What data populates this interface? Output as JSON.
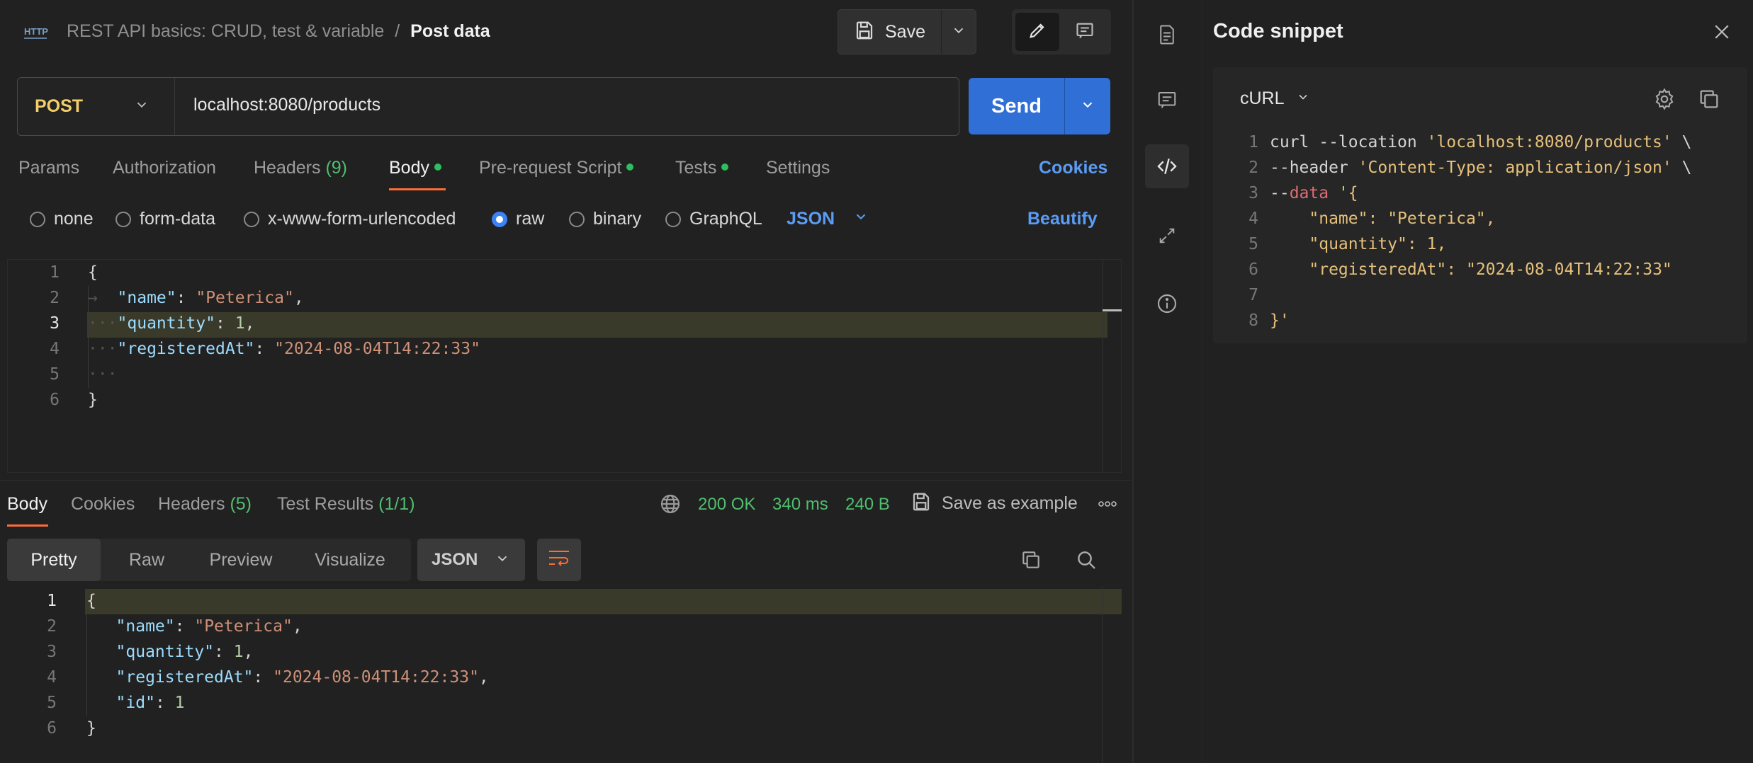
{
  "header": {
    "breadcrumb_parent": "REST API basics: CRUD, test & variable",
    "separator": "/",
    "title": "Post data",
    "save_label": "Save"
  },
  "request": {
    "method": "POST",
    "url": "localhost:8080/products",
    "send_label": "Send"
  },
  "request_tabs": {
    "params": "Params",
    "authorization": "Authorization",
    "headers": "Headers",
    "headers_count": "(9)",
    "body": "Body",
    "prerequest": "Pre-request Script",
    "tests": "Tests",
    "settings": "Settings",
    "cookies": "Cookies"
  },
  "body_types": {
    "none": "none",
    "form_data": "form-data",
    "urlencoded": "x-www-form-urlencoded",
    "raw": "raw",
    "binary": "binary",
    "graphql": "GraphQL",
    "format": "JSON",
    "beautify": "Beautify"
  },
  "request_body": {
    "lines": [
      "1",
      "2",
      "3",
      "4",
      "5",
      "6"
    ],
    "name_key": "\"name\"",
    "name_val": "\"Peterica\"",
    "qty_key": "\"quantity\"",
    "qty_val": "1",
    "reg_key": "\"registeredAt\"",
    "reg_val": "\"2024-08-04T14:22:33\""
  },
  "response_tabs": {
    "body": "Body",
    "cookies": "Cookies",
    "headers": "Headers",
    "headers_count": "(5)",
    "test_results": "Test Results",
    "test_count": "(1/1)",
    "status": "200 OK",
    "time": "340 ms",
    "size": "240 B",
    "save_example": "Save as example"
  },
  "response_views": {
    "pretty": "Pretty",
    "raw": "Raw",
    "preview": "Preview",
    "visualize": "Visualize",
    "format": "JSON"
  },
  "response_body": {
    "lines": [
      "1",
      "2",
      "3",
      "4",
      "5",
      "6"
    ],
    "name_key": "\"name\"",
    "name_val": "\"Peterica\"",
    "qty_key": "\"quantity\"",
    "qty_val": "1",
    "reg_key": "\"registeredAt\"",
    "reg_val": "\"2024-08-04T14:22:33\"",
    "id_key": "\"id\"",
    "id_val": "1"
  },
  "snippet": {
    "title": "Code snippet",
    "language": "cURL",
    "lines": [
      "1",
      "2",
      "3",
      "4",
      "5",
      "6",
      "7",
      "8"
    ],
    "l1_cmd": "curl --location ",
    "l1_str": "'localhost:8080/products'",
    "l1_end": " \\",
    "l2_cmd": "--header ",
    "l2_str": "'Content-Type: application/json'",
    "l2_end": " \\",
    "l3_flag": "--data",
    "l3_str": " '{",
    "l4_key": "\"name\"",
    "l4_val": "\"Peterica\"",
    "l5_key": "\"quantity\"",
    "l5_val": "1",
    "l6_key": "\"registeredAt\"",
    "l6_val": "\"2024-08-04T14:22:33\"",
    "l8": "}'"
  },
  "colors": {
    "accent_blue": "#2f6fd6",
    "status_green": "#4fbf6f",
    "method_yellow": "#f3cf6b",
    "link_blue": "#5b9cf5"
  }
}
